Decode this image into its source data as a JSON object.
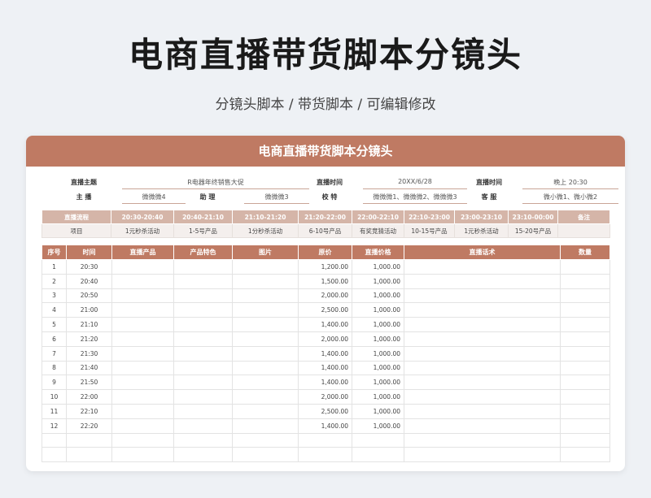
{
  "page": {
    "title": "电商直播带货脚本分镜头",
    "subtitle": "分镜头脚本 / 带货脚本 / 可编辑修改"
  },
  "sheet": {
    "header": "电商直播带货脚本分镜头",
    "info": {
      "theme_label": "直播主题",
      "theme_value": "R电器年终销售大促",
      "time_label": "直播时间",
      "time_value": "20XX/6/28",
      "time2_label": "直播时间",
      "time2_value": "晚上 20:30",
      "host_label": "主 播",
      "host_value": "微微微4",
      "assistant_label": "助 理",
      "assistant_value": "微微微3",
      "review_label": "校 特",
      "review_value": "微微微1、微微微2、微微微3",
      "service_label": "客 服",
      "service_value": "微小微1、微小微2"
    },
    "schedule": {
      "head": [
        "直播流程",
        "20:30-20:40",
        "20:40-21:10",
        "21:10-21:20",
        "21:20-22:00",
        "22:00-22:10",
        "22:10-23:00",
        "23:00-23:10",
        "23:10-00:00",
        "备注"
      ],
      "body": [
        "项目",
        "1元秒杀活动",
        "1-5号产品",
        "1分秒杀活动",
        "6-10号产品",
        "有奖竞猜活动",
        "10-15号产品",
        "1元秒杀活动",
        "15-20号产品",
        ""
      ]
    },
    "columns": [
      "序号",
      "时间",
      "直播产品",
      "产品特色",
      "图片",
      "原价",
      "直播价格",
      "直播话术",
      "数量"
    ],
    "rows": [
      {
        "no": "1",
        "time": "20:30",
        "price": "1,200.00",
        "live": "1,000.00"
      },
      {
        "no": "2",
        "time": "20:40",
        "price": "1,500.00",
        "live": "1,000.00"
      },
      {
        "no": "3",
        "time": "20:50",
        "price": "2,000.00",
        "live": "1,000.00"
      },
      {
        "no": "4",
        "time": "21:00",
        "price": "2,500.00",
        "live": "1,000.00"
      },
      {
        "no": "5",
        "time": "21:10",
        "price": "1,400.00",
        "live": "1,000.00"
      },
      {
        "no": "6",
        "time": "21:20",
        "price": "2,000.00",
        "live": "1,000.00"
      },
      {
        "no": "7",
        "time": "21:30",
        "price": "1,400.00",
        "live": "1,000.00"
      },
      {
        "no": "8",
        "time": "21:40",
        "price": "1,400.00",
        "live": "1,000.00"
      },
      {
        "no": "9",
        "time": "21:50",
        "price": "1,400.00",
        "live": "1,000.00"
      },
      {
        "no": "10",
        "time": "22:00",
        "price": "2,000.00",
        "live": "1,000.00"
      },
      {
        "no": "11",
        "time": "22:10",
        "price": "2,500.00",
        "live": "1,000.00"
      },
      {
        "no": "12",
        "time": "22:20",
        "price": "1,400.00",
        "live": "1,000.00"
      },
      {
        "no": "",
        "time": "",
        "price": "",
        "live": ""
      },
      {
        "no": "",
        "time": "",
        "price": "",
        "live": ""
      }
    ]
  }
}
